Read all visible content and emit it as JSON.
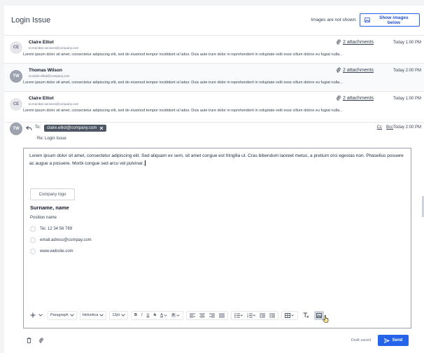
{
  "header": {
    "title": "Login Issue",
    "images_note": "Images are not shown.",
    "show_images_label": "Show images below"
  },
  "messages": [
    {
      "initials": "CE",
      "sender": "Claire Elliot",
      "address": "to:member.services@company.com",
      "preview": "Lorem ipsum dolor sit amet, consectetur adipiscing elit, sed do eiusmod tempor incididunt ut labor. Duis aute irure dolor in reprehenderit in voluptate velit esse cillum dolore eu fugiat nulla...",
      "attachments": "2 attachments",
      "time": "Today 1:00 PM"
    },
    {
      "initials": "TW",
      "sender": "Thomas Wilson",
      "address": "to:claire.elliot@company.com",
      "preview": "Lorem ipsum dolor sit amet, consectetur adipiscing elit, sed do eiusmod tempor incididunt ut labor. Duis aute irure dolor in reprehenderit in voluptate velit esse cillum dolore eu fugiat nulla...",
      "attachments": "2 attachments",
      "time": "Today 2:00 PM"
    },
    {
      "initials": "CE",
      "sender": "Claire Elliot",
      "address": "to:member.services@company.com",
      "preview": "Lorem ipsum dolor sit amet, consectetur adipiscing elit, sed do eiusmod tempor incididunt ut labor. Duis aute irure dolor in reprehenderit in voluptate velit esse cillum dolore eu fugiat nulla...",
      "attachments": "2 attachments",
      "time": "Today 1:00 PM"
    }
  ],
  "reply": {
    "initials": "TW",
    "to_label": "To:",
    "recipient": "claire.elliot@company.com",
    "cc": "Cc",
    "bcc": "Bcc",
    "time": "Today 2:00 PM",
    "subject": "Re: Login Issue"
  },
  "editor": {
    "body": "Lorem ipsum dolor sit amet, consectetur adipiscing elit. Sed aliquam ex sem, sit amet congue est fringilla ut. Cras bibendum laoreet metus, a pretium orci egestas non. Phasellus posuere ac augue a posuere. Morbi congue sed arcu vel pulvinar.",
    "logo": "Company logo",
    "sig_name": "Surname, name",
    "sig_position": "Position name",
    "sig_phone": "Tel. 12 34 56 789",
    "sig_email": "email.adress@compa​y.com",
    "sig_web": "www.website.com"
  },
  "toolbar": {
    "paragraph": "Paragraph",
    "font": "Helvetica",
    "size": "12pt",
    "bold": "B",
    "italic": "I",
    "underline": "U",
    "strike": "S",
    "text_color": "A",
    "highlight": "A"
  },
  "footer": {
    "draft": "Draft saved",
    "send": "Send"
  },
  "colors": {
    "accent": "#2563eb",
    "chip": "#4b5563"
  }
}
